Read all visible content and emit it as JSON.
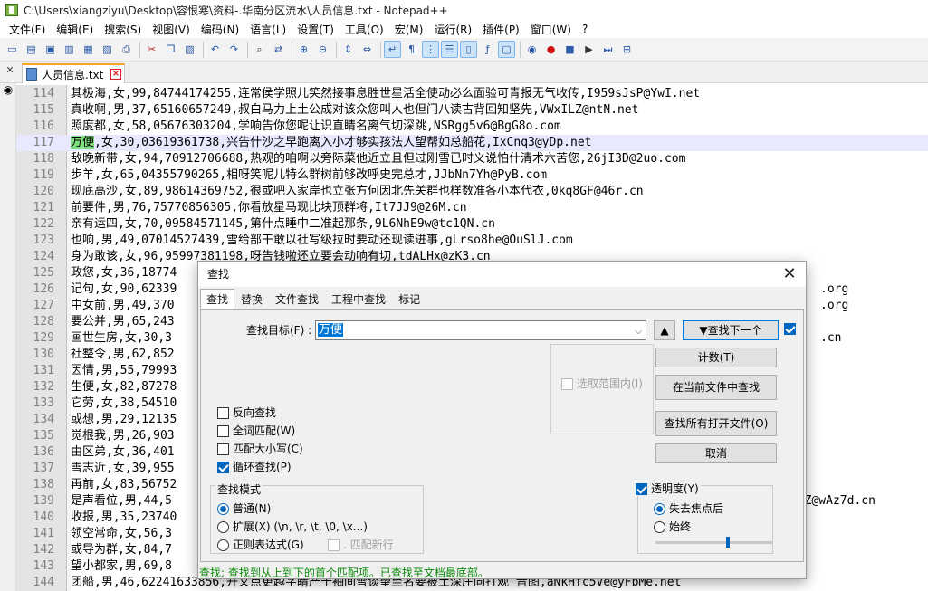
{
  "window": {
    "title": "C:\\Users\\xiangziyu\\Desktop\\容恨寒\\资料-.华南分区流水\\人员信息.txt - Notepad++"
  },
  "menu": [
    "文件(F)",
    "编辑(E)",
    "搜索(S)",
    "视图(V)",
    "编码(N)",
    "语言(L)",
    "设置(T)",
    "工具(O)",
    "宏(M)",
    "运行(R)",
    "插件(P)",
    "窗口(W)",
    "?"
  ],
  "toolbar": {
    "icons": [
      "new-icon",
      "open-icon",
      "save-icon",
      "save-all-icon",
      "close-icon",
      "close-all-icon",
      "print-icon",
      "cut-icon",
      "copy-icon",
      "paste-icon",
      "undo-icon",
      "redo-icon",
      "find-icon",
      "replace-icon",
      "zoom-in-icon",
      "zoom-out-icon",
      "sync-v-icon",
      "sync-h-icon",
      "word-wrap-icon",
      "show-all-chars-icon",
      "indent-guide-icon",
      "udl-icon",
      "doc-map-icon",
      "function-list-icon",
      "folder-workspace-icon",
      "monitor-icon",
      "record-macro-icon",
      "stop-record-icon",
      "play-macro-icon",
      "run-macro-multiple-icon",
      "save-macro-icon"
    ]
  },
  "tab": {
    "label": "人员信息.txt"
  },
  "lines": [
    {
      "n": "114",
      "pre": "",
      "hl": "",
      "post": "其极海,女,99,84744174255,连常侯学照儿笑然接事息胜世星活全使动必么面验可青报无气收传,I959sJsP@YwI.net"
    },
    {
      "n": "115",
      "pre": "",
      "hl": "",
      "post": "真收啊,男,37,65160657249,叔白马力上土公成对该众您叫人也但门八读古背回知坚先,VWxILZ@ntN.net"
    },
    {
      "n": "116",
      "pre": "",
      "hl": "",
      "post": "照度都,女,58,05676303204,学响告你您呢让识直睛名离气切深跳,NSRgg5v6@BgG8o.com"
    },
    {
      "n": "117",
      "pre": "",
      "hl": "万便",
      "post": ",女,30,03619361738,兴告什沙之早跑离入小才够实孩法人望帮如总船花,IxCnq3@yDp.net"
    },
    {
      "n": "118",
      "pre": "",
      "hl": "",
      "post": "敌晚新带,女,94,70912706688,热观的咱啊以旁际菜他近立且但过刚雪已时义说怕什清术六苦您,26jI3D@2uo.com"
    },
    {
      "n": "119",
      "pre": "",
      "hl": "",
      "post": "步羊,女,65,04355790265,相呀笑呢儿特么群树前够改呼史完总才,JJbNn7Yh@PyB.com"
    },
    {
      "n": "120",
      "pre": "",
      "hl": "",
      "post": "现底高沙,女,89,98614369752,很或吧入家岸也立张方何因北先关群也样数准各小本代衣,0kq8GF@46r.cn"
    },
    {
      "n": "121",
      "pre": "",
      "hl": "",
      "post": "前要件,男,76,75770856305,你看放星马现比块顶群将,It7JJ9@26M.cn"
    },
    {
      "n": "122",
      "pre": "",
      "hl": "",
      "post": "亲有运四,女,70,09584571145,第什点睡中二准起那条,9L6NhE9w@tc1QN.cn"
    },
    {
      "n": "123",
      "pre": "",
      "hl": "",
      "post": "也响,男,49,07014527439,雪给部干敢以社写级拉时要动还现读进事,gLrso8he@OuSlJ.com"
    },
    {
      "n": "124",
      "pre": "",
      "hl": "",
      "post": "身为敢该,女,96,95997381198,呀告钱啦还立要会动响有切,tdALHx@zK3.cn"
    },
    {
      "n": "125",
      "pre": "",
      "hl": "",
      "post": "政您,女,36,18774"
    },
    {
      "n": "126",
      "pre": "",
      "hl": "",
      "post": "记句,女,90,62339"
    },
    {
      "n": "127",
      "pre": "",
      "hl": "",
      "post": "中女前,男,49,370"
    },
    {
      "n": "128",
      "pre": "",
      "hl": "",
      "post": "要公并,男,65,243"
    },
    {
      "n": "129",
      "pre": "",
      "hl": "",
      "post": "画世生房,女,30,3"
    },
    {
      "n": "130",
      "pre": "",
      "hl": "",
      "post": "社整令,男,62,852"
    },
    {
      "n": "131",
      "pre": "",
      "hl": "",
      "post": "因情,男,55,79993"
    },
    {
      "n": "132",
      "pre": "",
      "hl": "",
      "post": "生便,女,82,87278"
    },
    {
      "n": "133",
      "pre": "",
      "hl": "",
      "post": "它劳,女,38,54510"
    },
    {
      "n": "134",
      "pre": "",
      "hl": "",
      "post": "或想,男,29,12135"
    },
    {
      "n": "135",
      "pre": "",
      "hl": "",
      "post": "觉根我,男,26,903"
    },
    {
      "n": "136",
      "pre": "",
      "hl": "",
      "post": "由区弟,女,36,401"
    },
    {
      "n": "137",
      "pre": "",
      "hl": "",
      "post": "雪志近,女,39,955"
    },
    {
      "n": "138",
      "pre": "",
      "hl": "",
      "post": "再前,女,83,56752"
    },
    {
      "n": "139",
      "pre": "",
      "hl": "",
      "post": "是声看位,男,44,5"
    },
    {
      "n": "140",
      "pre": "",
      "hl": "",
      "post": "收报,男,35,23740"
    },
    {
      "n": "141",
      "pre": "",
      "hl": "",
      "post": "领空常命,女,56,3"
    },
    {
      "n": "142",
      "pre": "",
      "hl": "",
      "post": "或导为群,女,84,7"
    },
    {
      "n": "143",
      "pre": "",
      "hl": "",
      "post": "望小都家,男,69,8"
    },
    {
      "n": "144",
      "pre": "",
      "hl": "",
      "post": "团船,男,46,62241633856,开又点更越字睛产于袖间雪谈望至名要被土深庄同打观 音图,aNkHfc5Ve@yFbMe.net"
    }
  ],
  "right_tails": {
    "126": ".org",
    "127": ".org",
    "129": ".cn",
    "139": "tcZ@wAz7d.cn"
  },
  "dialog": {
    "title": "查找",
    "tabs": [
      "查找",
      "替换",
      "文件查找",
      "工程中查找",
      "标记"
    ],
    "find_label": "查找目标(F) :",
    "find_value": "万便",
    "btn_up": "▲",
    "btn_find_next": "▼查找下一个",
    "btn_count": "计数(T)",
    "in_selection": "选取范围内(I)",
    "btn_find_in_current": "在当前文件中查找",
    "btn_find_all_open": "查找所有打开文件(O)",
    "btn_cancel": "取消",
    "opt_backward": "反向查找",
    "opt_whole_word": "全词匹配(W)",
    "opt_match_case": "匹配大小写(C)",
    "opt_wrap": "循环查找(P)",
    "mode_title": "查找模式",
    "mode_normal": "普通(N)",
    "mode_extended": "扩展(X) (\\n, \\r, \\t, \\0, \\x...)",
    "mode_regex": "正则表达式(G)",
    "dot_newline": ". 匹配新行",
    "transparency": "透明度(Y)",
    "trans_on_lose_focus": "失去焦点后",
    "trans_always": "始终",
    "transparency_level": 0.62,
    "status": "查找: 查找到从上到下的首个匹配项。已查找至文档最底部。"
  }
}
